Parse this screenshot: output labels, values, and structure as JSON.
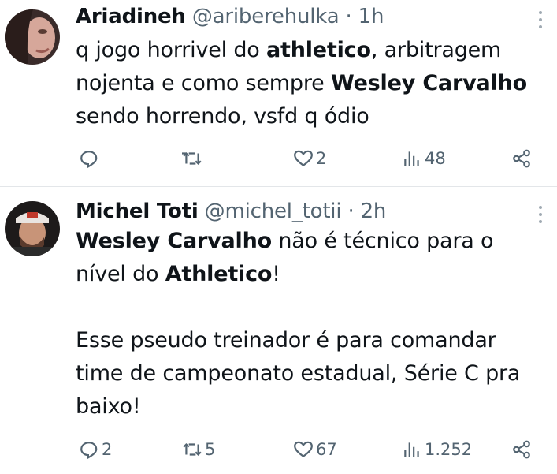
{
  "tweets": [
    {
      "name": "Ariadineh",
      "handle": "@ariberehulka",
      "separator": "·",
      "time": "1h",
      "body_lines": [
        [
          {
            "t": "q jogo horrivel do ",
            "b": false
          },
          {
            "t": "athletico",
            "b": true
          },
          {
            "t": ", arbitragem",
            "b": false
          }
        ],
        [
          {
            "t": "nojenta e como sempre ",
            "b": false
          },
          {
            "t": "Wesley Carvalho",
            "b": true
          }
        ],
        [
          {
            "t": "sendo horrendo, vsfd q ódio",
            "b": false
          }
        ]
      ],
      "replies": "",
      "retweets": "",
      "likes": "2",
      "views": "48"
    },
    {
      "name": "Michel Toti",
      "handle": "@michel_totii",
      "separator": "·",
      "time": "2h",
      "body_lines": [
        [
          {
            "t": "Wesley Carvalho",
            "b": true
          },
          {
            "t": " não é técnico para o",
            "b": false
          }
        ],
        [
          {
            "t": "nível do ",
            "b": false
          },
          {
            "t": "Athletico",
            "b": true
          },
          {
            "t": "!",
            "b": false
          }
        ],
        [],
        [
          {
            "t": "Esse pseudo treinador é para comandar",
            "b": false
          }
        ],
        [
          {
            "t": "time de campeonato estadual, Série C pra",
            "b": false
          }
        ],
        [
          {
            "t": "baixo!",
            "b": false
          }
        ]
      ],
      "replies": "2",
      "retweets": "5",
      "likes": "67",
      "views": "1.252"
    }
  ],
  "icons": [
    "reply-icon",
    "retweet-icon",
    "like-icon",
    "views-icon",
    "share-icon",
    "more-icon"
  ],
  "colors": {
    "text": "#0f1419",
    "muted": "#536471",
    "divider": "#e3e6e9"
  }
}
